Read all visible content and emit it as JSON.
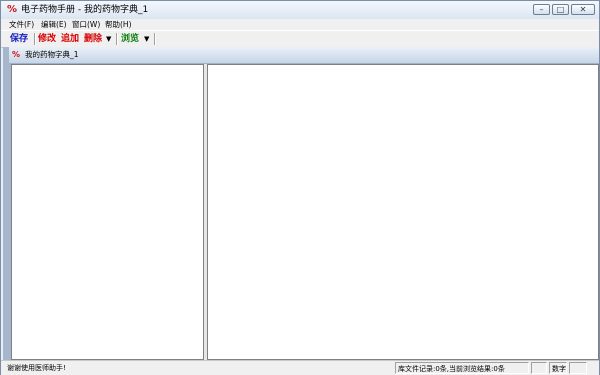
{
  "window": {
    "title": "电子药物手册 - 我的药物字典_1",
    "icon": "pill-app-icon",
    "controls": {
      "minimize": "–",
      "maximize": "□",
      "close": "✕"
    }
  },
  "menu": [
    {
      "label": "文件(F)"
    },
    {
      "label": "编辑(E)"
    },
    {
      "label": "窗口(W)"
    },
    {
      "label": "帮助(H)"
    }
  ],
  "toolbar": {
    "save": "保存",
    "modify": "修改",
    "add": "追加",
    "delete": "删除",
    "browse": "浏览",
    "dropdown_arrow": "▼"
  },
  "colors": {
    "save": "#1520c0",
    "edit_actions": "#d80000",
    "browse": "#108010",
    "mdi_background": "#a6b7cd"
  },
  "document": {
    "title": "我的药物字典_1",
    "icon": "pill-doc-icon"
  },
  "status": {
    "message": "谢谢使用医师助手!",
    "records": "库文件记录:0条,当前浏览结果:0条",
    "num_lock": "数字"
  }
}
